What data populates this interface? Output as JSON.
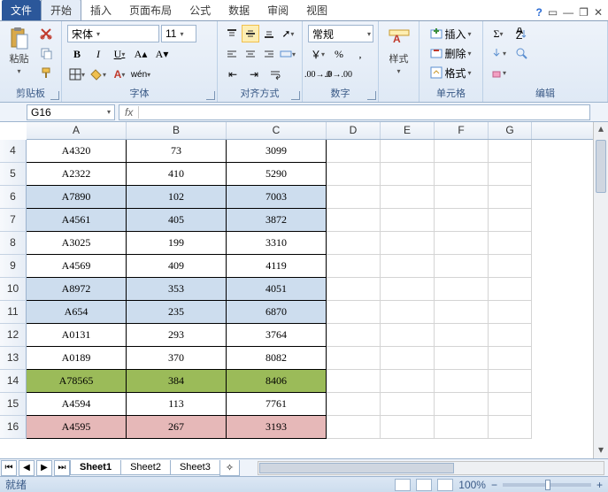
{
  "tabs": {
    "file": "文件",
    "home": "开始",
    "insert": "插入",
    "layout": "页面布局",
    "formula": "公式",
    "data": "数据",
    "review": "审阅",
    "view": "视图"
  },
  "groups": {
    "clipboard": "剪贴板",
    "font": "字体",
    "align": "对齐方式",
    "number": "数字",
    "styles": "样式",
    "cells": "单元格",
    "editing": "编辑"
  },
  "clipboard": {
    "paste": "粘贴"
  },
  "font": {
    "name": "宋体",
    "size": "11"
  },
  "number": {
    "format": "常规"
  },
  "styles": {
    "label": "样式"
  },
  "cells": {
    "insert": "插入",
    "delete": "删除",
    "format": "格式"
  },
  "namebox": "G16",
  "cols": {
    "widths": [
      113,
      113,
      113,
      61,
      61,
      61,
      49
    ]
  },
  "rows": [
    {
      "n": 4,
      "c": [
        "A4320",
        "73",
        "3099"
      ],
      "hl": ""
    },
    {
      "n": 5,
      "c": [
        "A2322",
        "410",
        "5290"
      ],
      "hl": ""
    },
    {
      "n": 6,
      "c": [
        "A7890",
        "102",
        "7003"
      ],
      "hl": "blue"
    },
    {
      "n": 7,
      "c": [
        "A4561",
        "405",
        "3872"
      ],
      "hl": "blue"
    },
    {
      "n": 8,
      "c": [
        "A3025",
        "199",
        "3310"
      ],
      "hl": ""
    },
    {
      "n": 9,
      "c": [
        "A4569",
        "409",
        "4119"
      ],
      "hl": ""
    },
    {
      "n": 10,
      "c": [
        "A8972",
        "353",
        "4051"
      ],
      "hl": "blue"
    },
    {
      "n": 11,
      "c": [
        "A654",
        "235",
        "6870"
      ],
      "hl": "blue"
    },
    {
      "n": 12,
      "c": [
        "A0131",
        "293",
        "3764"
      ],
      "hl": ""
    },
    {
      "n": 13,
      "c": [
        "A0189",
        "370",
        "8082"
      ],
      "hl": ""
    },
    {
      "n": 14,
      "c": [
        "A78565",
        "384",
        "8406"
      ],
      "hl": "green"
    },
    {
      "n": 15,
      "c": [
        "A4594",
        "113",
        "7761"
      ],
      "hl": ""
    },
    {
      "n": 16,
      "c": [
        "A4595",
        "267",
        "3193"
      ],
      "hl": "red"
    }
  ],
  "colLetters": [
    "A",
    "B",
    "C",
    "D",
    "E",
    "F",
    "G"
  ],
  "sheets": [
    "Sheet1",
    "Sheet2",
    "Sheet3"
  ],
  "status": {
    "ready": "就绪",
    "zoom": "100%"
  }
}
